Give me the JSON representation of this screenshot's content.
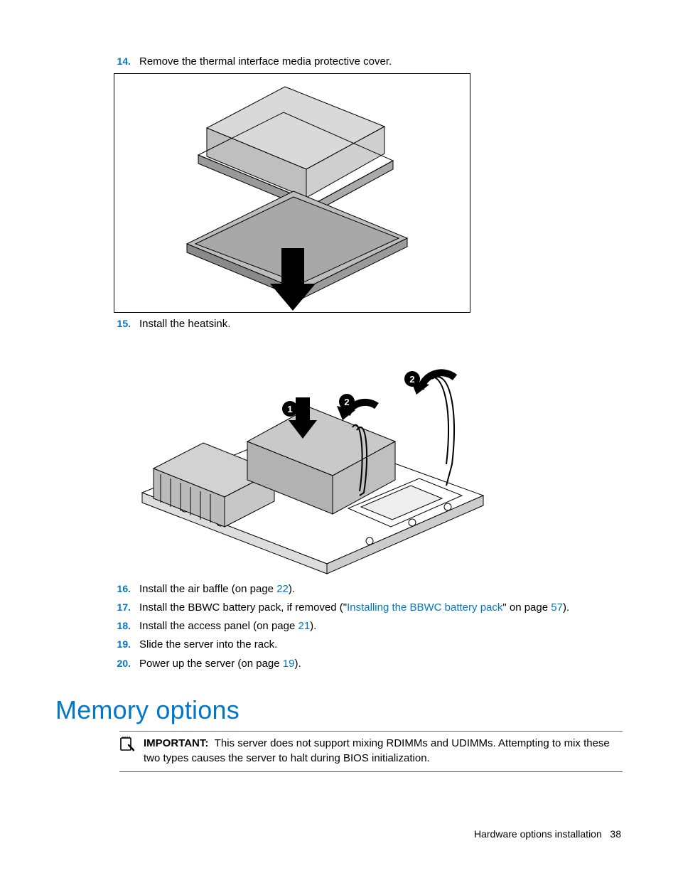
{
  "steps": {
    "s14": {
      "num": "14.",
      "text": "Remove the thermal interface media protective cover."
    },
    "s15": {
      "num": "15.",
      "text": "Install the heatsink."
    },
    "s16": {
      "num": "16.",
      "prefix": "Install the air baffle (on page ",
      "link": "22",
      "suffix": ")."
    },
    "s17": {
      "num": "17.",
      "prefix": "Install the BBWC battery pack, if removed (\"",
      "link1": "Installing the BBWC battery pack",
      "mid": "\" on page ",
      "link2": "57",
      "suffix": ")."
    },
    "s18": {
      "num": "18.",
      "prefix": "Install the access panel (on page ",
      "link": "21",
      "suffix": ")."
    },
    "s19": {
      "num": "19.",
      "text": "Slide the server into the rack."
    },
    "s20": {
      "num": "20.",
      "prefix": "Power up the server (on page ",
      "link": "19",
      "suffix": ")."
    }
  },
  "section_heading": "Memory options",
  "note": {
    "label": "IMPORTANT:",
    "text": "This server does not support mixing RDIMMs and UDIMMs. Attempting to mix these two types causes the server to halt during BIOS initialization."
  },
  "footer": {
    "section": "Hardware options installation",
    "page": "38"
  },
  "callouts": {
    "c1": "1",
    "c2a": "2",
    "c2b": "2"
  }
}
